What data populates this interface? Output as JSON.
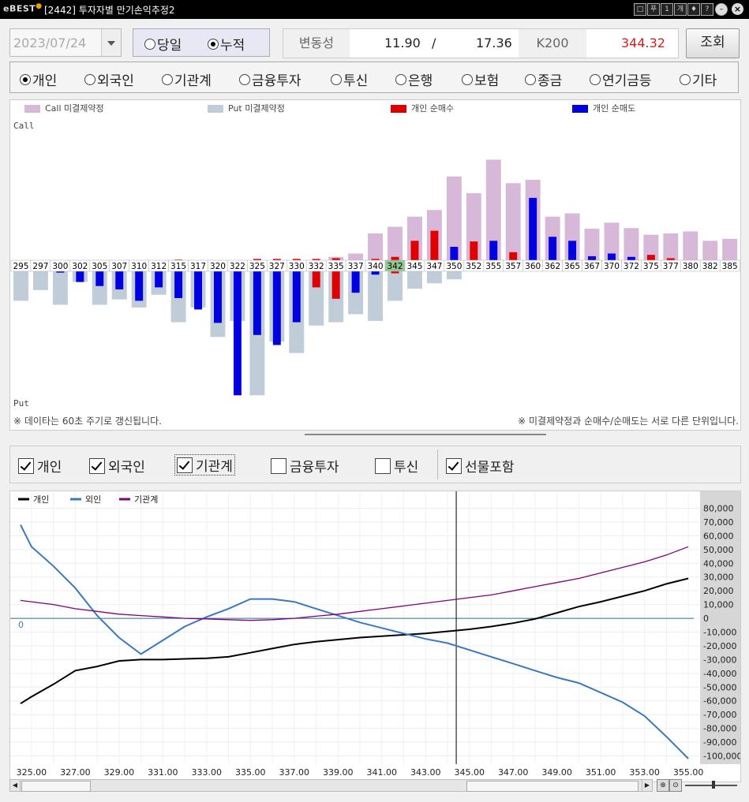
{
  "window": {
    "logo": "eBEST",
    "title": "[2442] 투자자별 만기손익추정2",
    "buttons": [
      "□",
      "푸",
      "1",
      "개",
      "♦",
      "?"
    ],
    "close": "×"
  },
  "controls": {
    "date": "2023/07/24",
    "mode_options": [
      {
        "label": "당일",
        "selected": false
      },
      {
        "label": "누적",
        "selected": true
      }
    ],
    "volatility_label": "변동성",
    "volatility_1": "11.90",
    "separator": "/",
    "volatility_2": "17.36",
    "index_label": "K200",
    "index_value": "344.32",
    "query_button": "조회"
  },
  "investor_radios": [
    {
      "label": "개인",
      "selected": true
    },
    {
      "label": "외국인",
      "selected": false
    },
    {
      "label": "기관계",
      "selected": false
    },
    {
      "label": "금융투자",
      "selected": false
    },
    {
      "label": "투신",
      "selected": false
    },
    {
      "label": "은행",
      "selected": false
    },
    {
      "label": "보험",
      "selected": false
    },
    {
      "label": "종금",
      "selected": false
    },
    {
      "label": "연기금등",
      "selected": false
    },
    {
      "label": "기타",
      "selected": false
    }
  ],
  "colors": {
    "call_oi": "#d8b8d8",
    "put_oi": "#c0ccd8",
    "net_buy": "#e00000",
    "net_sell": "#0000e0",
    "atm_strike": "#90c890",
    "line_individual": "#000000",
    "line_foreign": "#3a78c0",
    "line_institution": "#800080"
  },
  "chart_data": [
    {
      "type": "bar",
      "legend": [
        "Call 미결제약정",
        "Put 미결제약정",
        "개인 순매수",
        "개인 순매도"
      ],
      "call_axis_label": "Call",
      "put_axis_label": "Put",
      "categories": [
        "295",
        "297",
        "300",
        "302",
        "305",
        "307",
        "310",
        "312",
        "315",
        "317",
        "320",
        "322",
        "325",
        "327",
        "330",
        "332",
        "335",
        "337",
        "340",
        "342",
        "345",
        "347",
        "350",
        "352",
        "355",
        "357",
        "360",
        "362",
        "365",
        "367",
        "370",
        "372",
        "375",
        "377",
        "380",
        "382",
        "385"
      ],
      "highlight_category": "342",
      "call_oi": [
        0,
        0,
        0,
        0,
        0,
        0,
        0,
        0,
        0,
        0,
        0,
        0,
        0,
        0,
        0,
        0,
        0.5,
        1,
        4,
        5,
        6.5,
        7.5,
        12.5,
        10,
        15,
        11.5,
        12,
        6.5,
        7,
        4.7,
        5.6,
        4.8,
        3.8,
        4,
        4.3,
        2.9,
        3.2
      ],
      "call_net": [
        0,
        0,
        0,
        0,
        0,
        0,
        0,
        0,
        0.1,
        0,
        0,
        0,
        0.2,
        0.2,
        0.2,
        0.2,
        0.3,
        0,
        0.2,
        0.5,
        2.9,
        4.4,
        2,
        2.8,
        2.9,
        1.2,
        9.3,
        3.5,
        2.9,
        0.6,
        1,
        0.5,
        0.8,
        0.3,
        0,
        0,
        0
      ],
      "put_oi": [
        -4.4,
        -2.8,
        -5,
        -1.6,
        -5,
        -4.2,
        -5.4,
        -3.5,
        -7.6,
        -5.4,
        -9.8,
        -7.4,
        -18.5,
        -10.5,
        -12.2,
        -8.1,
        -7.6,
        -6.4,
        -7.4,
        -4.4,
        -2.6,
        -1.8,
        -1.2,
        0,
        0,
        0,
        0,
        0,
        0,
        0,
        0,
        0,
        0,
        0,
        0,
        0,
        0
      ],
      "put_net": [
        0,
        0,
        -0.2,
        -1.6,
        -2.2,
        -2.7,
        -4.4,
        -2.4,
        -4,
        -5.7,
        -7.7,
        -18.5,
        -9.5,
        -11,
        -7.6,
        -2.4,
        -4.1,
        -3.2,
        -0.5,
        -0.3,
        0,
        0,
        0,
        0,
        0,
        0,
        0,
        0,
        0,
        0,
        0,
        0,
        0,
        0,
        0,
        0,
        0
      ]
    },
    {
      "type": "line",
      "legend": [
        "개인",
        "외인",
        "기관계"
      ],
      "x": [
        325,
        327,
        329,
        331,
        333,
        335,
        337,
        339,
        341,
        343,
        345,
        347,
        349,
        351,
        353,
        355
      ],
      "x_tick_labels": [
        "325.00",
        "327.00",
        "329.00",
        "331.00",
        "333.00",
        "335.00",
        "337.00",
        "339.00",
        "341.00",
        "343.00",
        "345.00",
        "347.00",
        "349.00",
        "351.00",
        "353.00",
        "355.00"
      ],
      "y_tick_labels": [
        "80,000",
        "70,000",
        "60,000",
        "50,000",
        "40,000",
        "30,000",
        "20,000",
        "10,000",
        "0",
        "-10,000",
        "-20,000",
        "-30,000",
        "-40,000",
        "-50,000",
        "-60,000",
        "-70,000",
        "-80,000",
        "-90,000",
        "-100,000"
      ],
      "ylim": [
        -100000,
        80000
      ],
      "zero_label": "0",
      "cursor_x": 344.4,
      "series": [
        {
          "name": "개인",
          "points": [
            [
              324.5,
              -62000
            ],
            [
              325,
              -57000
            ],
            [
              326,
              -48000
            ],
            [
              327,
              -38000
            ],
            [
              328,
              -35000
            ],
            [
              329,
              -31000
            ],
            [
              330,
              -30000
            ],
            [
              331,
              -30000
            ],
            [
              332,
              -29500
            ],
            [
              333,
              -29000
            ],
            [
              334,
              -28000
            ],
            [
              335,
              -25000
            ],
            [
              336,
              -22000
            ],
            [
              337,
              -19000
            ],
            [
              338,
              -17000
            ],
            [
              339,
              -15500
            ],
            [
              340,
              -14000
            ],
            [
              341,
              -13000
            ],
            [
              342,
              -12000
            ],
            [
              343,
              -11000
            ],
            [
              344,
              -9500
            ],
            [
              345,
              -8000
            ],
            [
              346,
              -6000
            ],
            [
              347,
              -3500
            ],
            [
              348,
              -500
            ],
            [
              349,
              4000
            ],
            [
              350,
              8500
            ],
            [
              351,
              12000
            ],
            [
              352,
              16000
            ],
            [
              353,
              20000
            ],
            [
              354,
              25000
            ],
            [
              355,
              29000
            ]
          ]
        },
        {
          "name": "외인",
          "points": [
            [
              324.5,
              68000
            ],
            [
              325,
              52000
            ],
            [
              326,
              38000
            ],
            [
              327,
              22000
            ],
            [
              328,
              2000
            ],
            [
              329,
              -14000
            ],
            [
              330,
              -26000
            ],
            [
              331,
              -16000
            ],
            [
              332,
              -6000
            ],
            [
              333,
              1000
            ],
            [
              334,
              7000
            ],
            [
              335,
              14000
            ],
            [
              336,
              14000
            ],
            [
              337,
              12000
            ],
            [
              338,
              7000
            ],
            [
              339,
              2000
            ],
            [
              340,
              -3000
            ],
            [
              341,
              -7000
            ],
            [
              342,
              -11000
            ],
            [
              343,
              -15000
            ],
            [
              344,
              -18000
            ],
            [
              345,
              -23000
            ],
            [
              346,
              -28000
            ],
            [
              347,
              -33000
            ],
            [
              348,
              -38000
            ],
            [
              349,
              -43000
            ],
            [
              350,
              -47000
            ],
            [
              351,
              -54000
            ],
            [
              352,
              -61000
            ],
            [
              353,
              -71000
            ],
            [
              354,
              -86000
            ],
            [
              355,
              -102000
            ]
          ]
        },
        {
          "name": "기관계",
          "points": [
            [
              324.5,
              13000
            ],
            [
              325,
              12000
            ],
            [
              326,
              10000
            ],
            [
              327,
              7000
            ],
            [
              328,
              5000
            ],
            [
              329,
              3000
            ],
            [
              330,
              2000
            ],
            [
              331,
              1000
            ],
            [
              332,
              0
            ],
            [
              333,
              -500
            ],
            [
              334,
              -1000
            ],
            [
              335,
              -1500
            ],
            [
              336,
              -1000
            ],
            [
              337,
              0
            ],
            [
              338,
              1500
            ],
            [
              339,
              3000
            ],
            [
              340,
              5000
            ],
            [
              341,
              7000
            ],
            [
              342,
              9000
            ],
            [
              343,
              11000
            ],
            [
              344,
              13000
            ],
            [
              345,
              15000
            ],
            [
              346,
              17000
            ],
            [
              347,
              20000
            ],
            [
              348,
              23000
            ],
            [
              349,
              26000
            ],
            [
              350,
              29000
            ],
            [
              351,
              33000
            ],
            [
              352,
              37000
            ],
            [
              353,
              41000
            ],
            [
              354,
              46000
            ],
            [
              355,
              52000
            ]
          ]
        }
      ]
    }
  ],
  "notes": {
    "left": "※ 데이타는 60초 주기로 갱신됩니다.",
    "right": "※ 미결제약정과 순매수/순매도는 서로 다른 단위입니다."
  },
  "series_checkboxes": [
    {
      "label": "개인",
      "checked": true
    },
    {
      "label": "외국인",
      "checked": true
    },
    {
      "label": "기관계",
      "checked": true
    },
    {
      "label": "금융투자",
      "checked": false
    },
    {
      "label": "투신",
      "checked": false
    },
    {
      "label": "선물포함",
      "checked": true
    }
  ]
}
